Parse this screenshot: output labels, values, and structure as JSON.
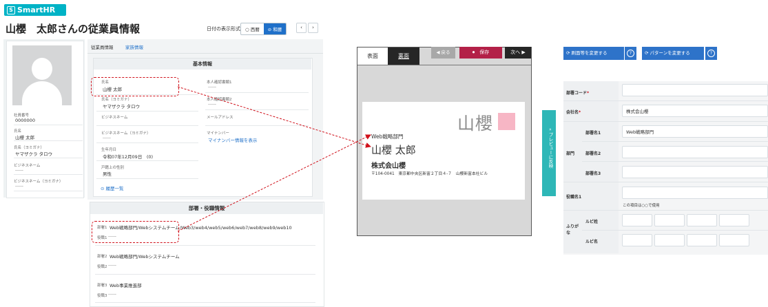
{
  "logo": {
    "mark": "S",
    "text": "SmartHR"
  },
  "employee": {
    "title": "山櫻　太郎さんの従業員情報",
    "date_format_label": "日付の表示形式",
    "date_options": [
      "西暦",
      "和暦"
    ],
    "selected_date_option": "和暦",
    "nav_prev": "‹",
    "nav_next": "›"
  },
  "side_fields": [
    {
      "label": "社員番号",
      "value": "0000000"
    },
    {
      "label": "氏名",
      "value": "山櫻 太郎"
    },
    {
      "label": "氏名（ヨミガナ）",
      "value": "ヤマザクラ タロウ"
    },
    {
      "label": "ビジネスネーム",
      "value": "------"
    },
    {
      "label": "ビジネスネーム（ヨミガナ）",
      "value": "------"
    }
  ],
  "tabs": [
    "従業員情報",
    "家族情報"
  ],
  "basic_info": {
    "header": "基本情報",
    "left": [
      {
        "label": "氏名",
        "value": "山櫻 太郎"
      },
      {
        "label": "氏名（ヨミガナ）",
        "value": "ヤマザクラ タロウ"
      },
      {
        "label": "ビジネスネーム",
        "value": ""
      },
      {
        "label": "ビジネスネーム（ヨミガナ）",
        "value": "------"
      },
      {
        "label": "生年月日",
        "value": "令和07年12月09日　(0)"
      },
      {
        "label": "戸籍上の性別",
        "value": "男性"
      }
    ],
    "right": [
      {
        "label": "本人確認書類1",
        "value": "------"
      },
      {
        "label": "本人確認書類2",
        "value": "------"
      },
      {
        "label": "メールアドレス",
        "value": ""
      },
      {
        "label": "マイナンバー",
        "value": "マイナンバー情報を表示"
      }
    ],
    "history_link": "履歴一覧"
  },
  "dept_info": {
    "header": "部署・役職情報",
    "rows": [
      {
        "dept_label": "部署1",
        "dept_value": "Web戦略部門/Webシステムチーム/Web3/web4/web5/web6/web7/web8/web9/web10",
        "role_label": "役職1",
        "role_value": "------"
      },
      {
        "dept_label": "部署2",
        "dept_value": "Web戦略部門/Webシステムチーム",
        "role_label": "役職2",
        "role_value": "------"
      },
      {
        "dept_label": "部署3",
        "dept_value": "Web事業推進部",
        "role_label": "役職3",
        "role_value": "------"
      }
    ]
  },
  "card_preview": {
    "tab_front": "表面",
    "tab_back": "裏面",
    "btn_prev": "戻る",
    "btn_save": "保存",
    "btn_next": "次へ",
    "logo_text": "山櫻",
    "logo_color": "#f7b6c5",
    "dept": "Web戦略部門",
    "name": "山櫻 太郎",
    "company": "株式会山櫻",
    "address": "〒104-0041　東京都中央区新富２丁目４-７　山櫻新富本社ビル"
  },
  "pull_tab": "« プレビューに反映",
  "form": {
    "btn_change_layout": "刷面等を変更する",
    "btn_change_pattern": "パターンを変更する",
    "help": "?",
    "dept_code": {
      "label": "部署コード",
      "value": ""
    },
    "company": {
      "label": "会社名",
      "value": "株式会山櫻"
    },
    "dept_group": "部門",
    "dept_names": [
      {
        "label": "部署名1",
        "value": "Web戦略部門"
      },
      {
        "label": "部署名2",
        "value": ""
      },
      {
        "label": "部署名3",
        "value": ""
      }
    ],
    "role": {
      "label": "役職名1",
      "value": "",
      "note": "この項目は○○で使用"
    },
    "furigana": "ふりがな",
    "furigana_rows": [
      "ルビ姓",
      "ルビ名"
    ]
  },
  "colors": {
    "accent": "#1f70c9",
    "brand": "#00b3c6",
    "save": "#b32148",
    "highlight": "#d0101a",
    "pull_tab": "#2eb7b7"
  }
}
